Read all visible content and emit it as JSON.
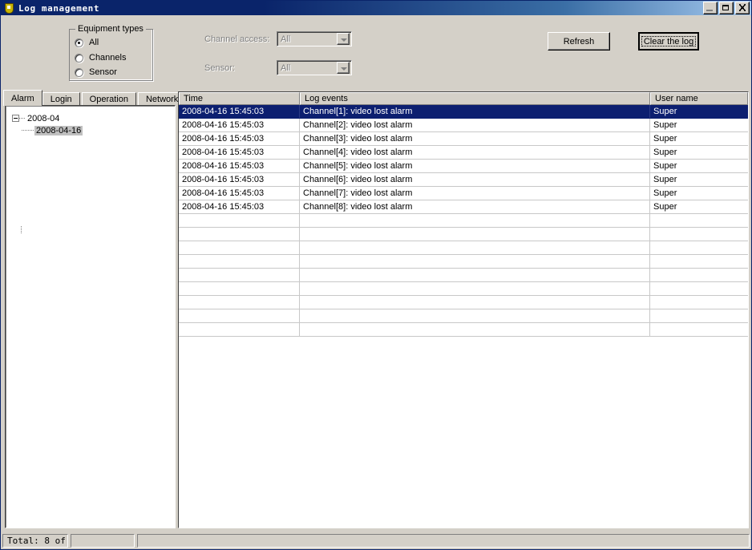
{
  "window": {
    "title": "Log management",
    "icon": "shield-icon",
    "controls": {
      "minimize": "minimize-icon",
      "maximize": "maximize-icon",
      "close": "close-icon"
    }
  },
  "filters": {
    "equipment_types": {
      "legend": "Equipment types",
      "options": [
        {
          "label": "All",
          "selected": true
        },
        {
          "label": "Channels",
          "selected": false
        },
        {
          "label": "Sensor",
          "selected": false
        }
      ]
    },
    "channel_access": {
      "label": "Channel access:",
      "value": "All",
      "enabled": false
    },
    "sensor": {
      "label": "Sensor:",
      "value": "All",
      "enabled": false
    }
  },
  "actions": {
    "refresh": "Refresh",
    "clear_log": "Clear the log"
  },
  "tabs": [
    {
      "label": "Alarm",
      "selected": true
    },
    {
      "label": "Login",
      "selected": false
    },
    {
      "label": "Operation",
      "selected": false
    },
    {
      "label": "Network",
      "selected": false
    }
  ],
  "tree": {
    "root": {
      "label": "2008-04",
      "expanded": true
    },
    "children": [
      {
        "label": "2008-04-16",
        "selected": true
      }
    ]
  },
  "list": {
    "columns": [
      "Time",
      "Log events",
      "User name"
    ],
    "rows": [
      {
        "time": "2008-04-16 15:45:03",
        "event": "Channel[1]: video lost alarm",
        "user": "Super",
        "selected": true
      },
      {
        "time": "2008-04-16 15:45:03",
        "event": "Channel[2]: video lost alarm",
        "user": "Super",
        "selected": false
      },
      {
        "time": "2008-04-16 15:45:03",
        "event": "Channel[3]: video lost alarm",
        "user": "Super",
        "selected": false
      },
      {
        "time": "2008-04-16 15:45:03",
        "event": "Channel[4]: video lost alarm",
        "user": "Super",
        "selected": false
      },
      {
        "time": "2008-04-16 15:45:03",
        "event": "Channel[5]: video lost alarm",
        "user": "Super",
        "selected": false
      },
      {
        "time": "2008-04-16 15:45:03",
        "event": "Channel[6]: video lost alarm",
        "user": "Super",
        "selected": false
      },
      {
        "time": "2008-04-16 15:45:03",
        "event": "Channel[7]: video lost alarm",
        "user": "Super",
        "selected": false
      },
      {
        "time": "2008-04-16 15:45:03",
        "event": "Channel[8]: video lost alarm",
        "user": "Super",
        "selected": false
      }
    ],
    "empty_row_count": 9
  },
  "statusbar": {
    "total": "Total: 8 of",
    "panel2": "",
    "panel3": ""
  },
  "colors": {
    "titlebar": "#0a246a",
    "face": "#d4d0c8",
    "selection": "#0c1f70",
    "tree_selection": "#c0c0c0",
    "disabled_text": "#808080"
  }
}
